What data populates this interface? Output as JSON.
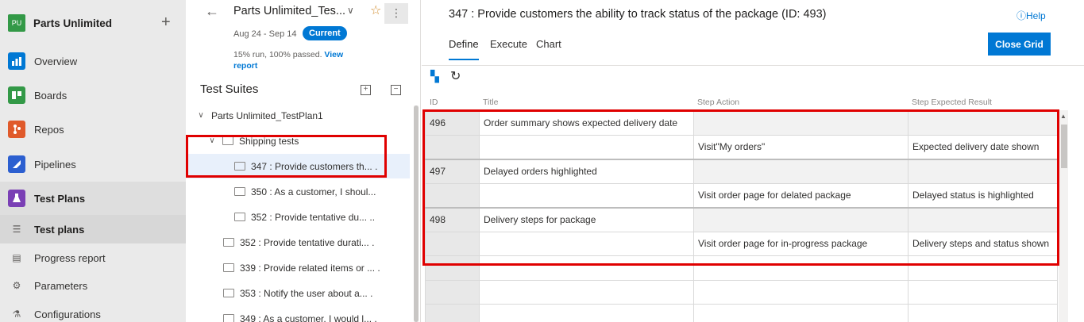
{
  "org": {
    "logo": "PU",
    "name": "Parts Unlimited"
  },
  "nav": {
    "items": [
      {
        "label": "Overview",
        "icon": "overview-icon",
        "color": "#0078d4"
      },
      {
        "label": "Boards",
        "icon": "boards-icon",
        "color": "#339947"
      },
      {
        "label": "Repos",
        "icon": "repos-icon",
        "color": "#e05a2b"
      },
      {
        "label": "Pipelines",
        "icon": "pipelines-icon",
        "color": "#2c5fd0"
      },
      {
        "label": "Test Plans",
        "icon": "test-plans-icon",
        "color": "#7a3fb5"
      }
    ],
    "sub_items": [
      {
        "label": "Test plans",
        "icon": "test-plans-doc-icon"
      },
      {
        "label": "Progress report",
        "icon": "progress-report-icon"
      },
      {
        "label": "Parameters",
        "icon": "parameters-icon"
      },
      {
        "label": "Configurations",
        "icon": "configurations-icon"
      }
    ]
  },
  "plan": {
    "title": "Parts Unlimited_Tes...",
    "dates": "Aug 24 - Sep 14",
    "badge": "Current",
    "run_summary": "15% run, 100% passed.",
    "view_report": "View report"
  },
  "suites": {
    "title": "Test Suites",
    "tree": [
      {
        "label": "Parts Unlimited_TestPlan1",
        "level": 0,
        "caret": "expanded"
      },
      {
        "label": "Shipping tests",
        "level": 1,
        "caret": "expanded"
      },
      {
        "label": "347 : Provide customers th...  .",
        "level": 2,
        "selected": true
      },
      {
        "label": "350 : As a customer, I shoul...",
        "level": 2
      },
      {
        "label": "352 : Provide tentative du...  ..",
        "level": 2
      },
      {
        "label": "352 : Provide tentative durati... .",
        "level": 1
      },
      {
        "label": "339 : Provide related items or ... .",
        "level": 1
      },
      {
        "label": "353 : Notify the user about a... .",
        "level": 1
      },
      {
        "label": "349 : As a customer, I would l... .",
        "level": 1
      }
    ]
  },
  "main": {
    "title": "347 : Provide customers the ability to track status of the package (ID: 493)",
    "help": "Help",
    "tabs": [
      "Define",
      "Execute",
      "Chart"
    ],
    "close_grid": "Close Grid",
    "columns": [
      "ID",
      "Title",
      "Step Action",
      "Step Expected Result"
    ],
    "rows": [
      {
        "id": "496",
        "title": "Order summary shows expected delivery date",
        "action": "",
        "result": ""
      },
      {
        "id": "",
        "title": "",
        "action": "Visit\"My orders\"",
        "result": "Expected delivery date shown"
      },
      {
        "id": "497",
        "title": "Delayed orders highlighted",
        "action": "",
        "result": ""
      },
      {
        "id": "",
        "title": "",
        "action": "Visit order page for delated package",
        "result": "Delayed status is highlighted"
      },
      {
        "id": "498",
        "title": "Delivery steps for package",
        "action": "",
        "result": ""
      },
      {
        "id": "",
        "title": "",
        "action": "Visit order page for in-progress package",
        "result": "Delivery steps and status shown"
      },
      {
        "id": "",
        "title": "",
        "action": "",
        "result": ""
      },
      {
        "id": "",
        "title": "",
        "action": "",
        "result": ""
      },
      {
        "id": "",
        "title": "",
        "action": "",
        "result": ""
      }
    ]
  },
  "colors": {
    "accent": "#0078d4",
    "highlight": "#e00000"
  }
}
